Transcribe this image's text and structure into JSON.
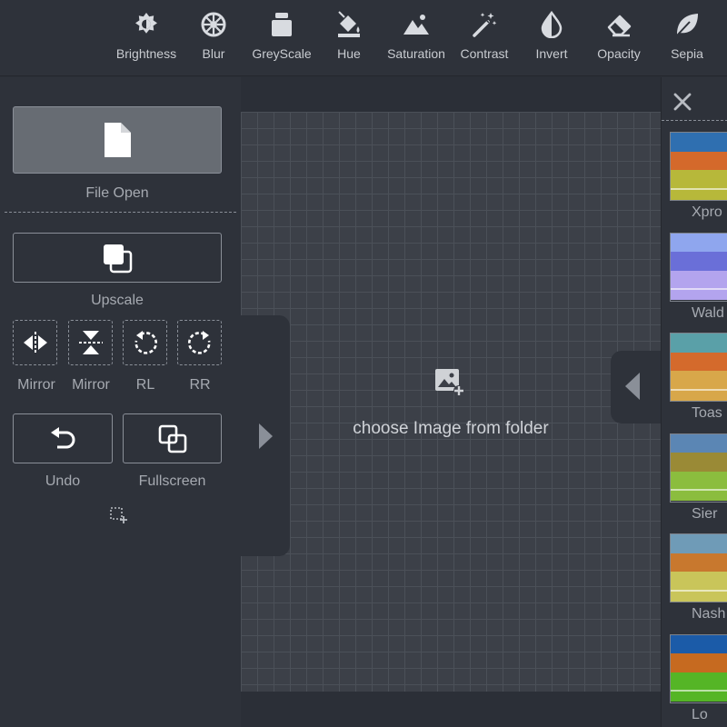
{
  "toolbar": {
    "tools": [
      {
        "label": "Brightness",
        "icon": "brightness-icon"
      },
      {
        "label": "Blur",
        "icon": "blur-icon"
      },
      {
        "label": "GreyScale",
        "icon": "greyscale-icon"
      },
      {
        "label": "Hue",
        "icon": "hue-icon"
      },
      {
        "label": "Saturation",
        "icon": "saturation-icon"
      },
      {
        "label": "Contrast",
        "icon": "contrast-icon"
      },
      {
        "label": "Invert",
        "icon": "invert-icon"
      },
      {
        "label": "Opacity",
        "icon": "opacity-icon"
      },
      {
        "label": "Sepia",
        "icon": "sepia-icon"
      }
    ]
  },
  "left_panel": {
    "file_open_label": "File Open",
    "upscale_label": "Upscale",
    "mirror_h_label": "Mirror",
    "mirror_v_label": "Mirror",
    "rotate_left_label": "RL",
    "rotate_right_label": "RR",
    "undo_label": "Undo",
    "fullscreen_label": "Fullscreen"
  },
  "canvas": {
    "placeholder": "choose Image from folder"
  },
  "filters": {
    "items": [
      {
        "label": "Xpro",
        "sky": "#2f6fb0",
        "trees": "#d4692b",
        "field": "#b7b83a"
      },
      {
        "label": "Wald",
        "sky": "#8fa6ee",
        "trees": "#6a6fd8",
        "field": "#b3a4ee"
      },
      {
        "label": "Toas",
        "sky": "#5aa0a8",
        "trees": "#d46a2c",
        "field": "#d8a74a"
      },
      {
        "label": "Sier",
        "sky": "#5b86b4",
        "trees": "#9a8a36",
        "field": "#8bbd3e"
      },
      {
        "label": "Nash",
        "sky": "#6f9bb7",
        "trees": "#c8782e",
        "field": "#c9c55a"
      },
      {
        "label": "Lo",
        "sky": "#1b5ba8",
        "trees": "#c66a20",
        "field": "#55b526"
      }
    ]
  },
  "colors": {
    "panel": "#2e323a",
    "canvas_bg": "#3c4048",
    "text": "#c9ccd1",
    "muted_text": "#a6aab1",
    "border": "#8a8f98"
  }
}
